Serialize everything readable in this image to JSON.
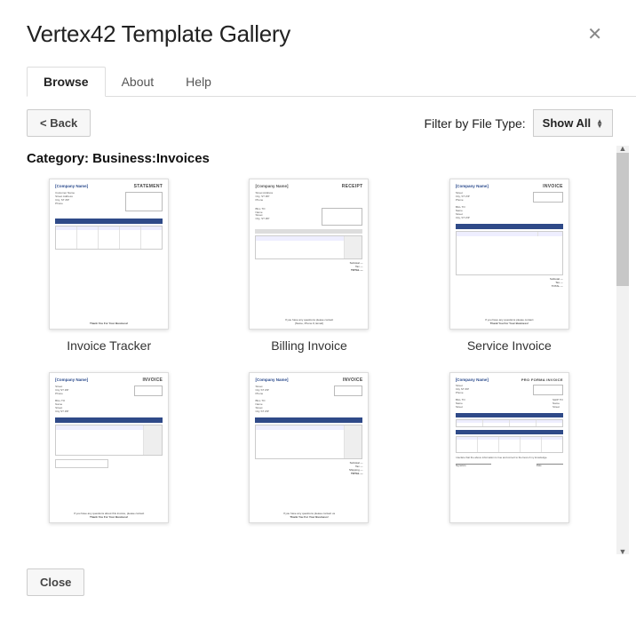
{
  "header": {
    "title": "Vertex42 Template Gallery"
  },
  "tabs": {
    "browse": "Browse",
    "about": "About",
    "help": "Help"
  },
  "toolbar": {
    "back_label": "< Back",
    "filter_label": "Filter by File Type:",
    "filter_value": "Show All"
  },
  "category_heading": "Category: Business:Invoices",
  "cards": [
    {
      "label": "Invoice Tracker",
      "doctype": "STATEMENT"
    },
    {
      "label": "Billing Invoice",
      "doctype": "RECEIPT"
    },
    {
      "label": "Service Invoice",
      "doctype": "INVOICE"
    },
    {
      "label": "",
      "doctype": "INVOICE"
    },
    {
      "label": "",
      "doctype": "INVOICE"
    },
    {
      "label": "",
      "doctype": "PRO FORMA INVOICE"
    }
  ],
  "thumb_text": {
    "company": "[Company Name]",
    "thank_you": "Thank You For Your Business!"
  },
  "footer": {
    "close_label": "Close"
  }
}
